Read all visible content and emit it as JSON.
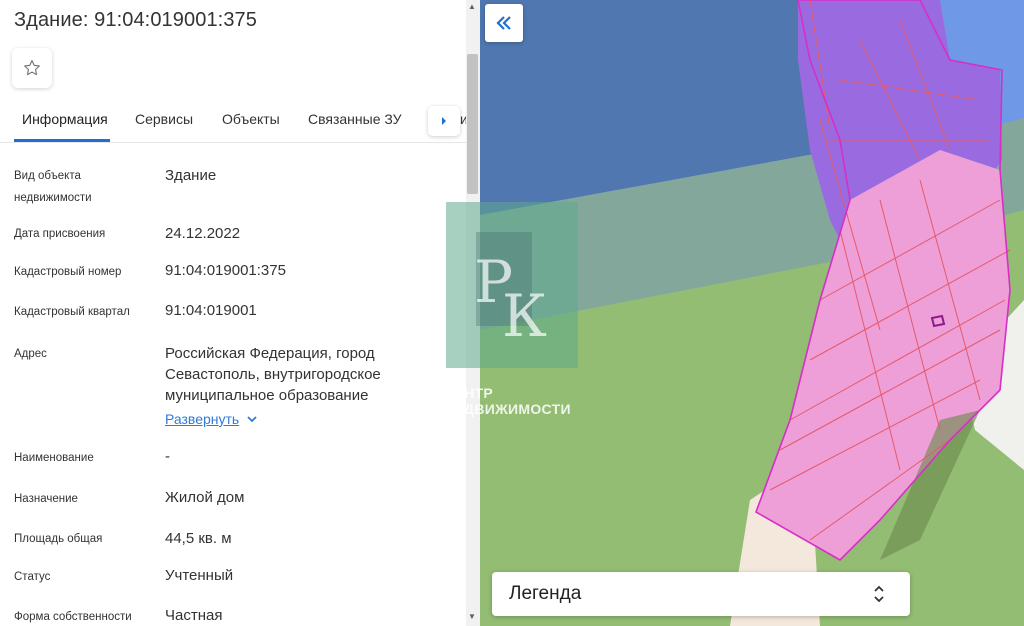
{
  "header": {
    "title": "Здание: 91:04:019001:375"
  },
  "icons": {
    "favorite": "star-outline-icon",
    "tabs_next": "caret-right-icon",
    "collapse": "double-chevron-left-icon",
    "expand": "chevron-down-icon",
    "legend_toggle": "chevron-up-down-icon"
  },
  "tabs": [
    {
      "label": "Информация",
      "active": true
    },
    {
      "label": "Сервисы"
    },
    {
      "label": "Объекты"
    },
    {
      "label": "Связанные ЗУ"
    }
  ],
  "tabs_overflow_text": "и",
  "fields": {
    "type": {
      "label_line1": "Вид объекта",
      "label_line2": "недвижимости",
      "value": "Здание"
    },
    "date": {
      "label": "Дата присвоения",
      "value": "24.12.2022"
    },
    "cad_num": {
      "label": "Кадастровый номер",
      "value": "91:04:019001:375"
    },
    "cad_quarter": {
      "label": "Кадастровый квартал",
      "value": "91:04:019001"
    },
    "address": {
      "label": "Адрес",
      "line1": "Российская Федерация, город",
      "line2": "Севастополь, внутригородское",
      "line3": "муниципальное образование",
      "expand": "Развернуть"
    },
    "name": {
      "label": "Наименование",
      "value": "-"
    },
    "purpose": {
      "label": "Назначение",
      "value": "Жилой дом"
    },
    "area": {
      "label": "Площадь общая",
      "value": "44,5 кв. м"
    },
    "status": {
      "label": "Статус",
      "value": "Учтенный"
    },
    "ownership": {
      "label": "Форма собственности",
      "value": "Частная"
    }
  },
  "map": {
    "legend_label": "Легенда",
    "watermark": {
      "line1": "ЦЕНТР",
      "line2": "НЕДВИЖИМОСТИ",
      "monogram": "РК"
    },
    "colors": {
      "blue_zone": "#5077b0",
      "green_zone": "#93bd72",
      "parcel_pink": "#ef9fd8",
      "parcel_purple": "#9a6be0",
      "outline": "#d62fc6"
    }
  }
}
